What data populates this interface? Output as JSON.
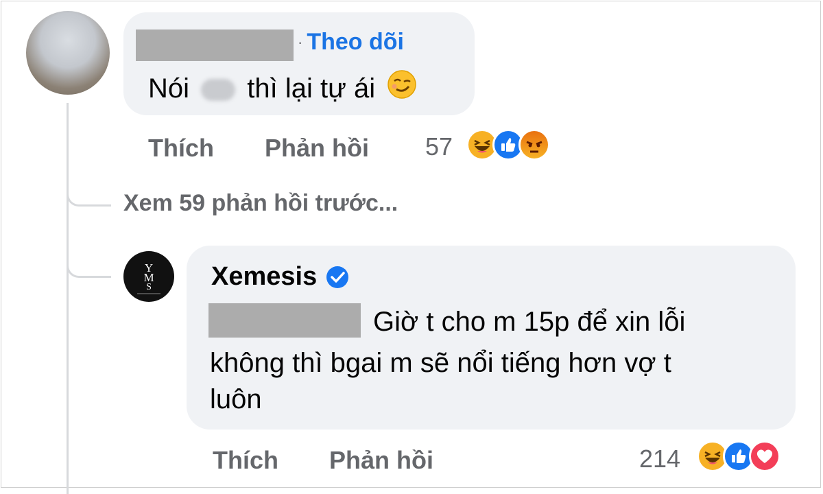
{
  "comment1": {
    "follow_label": "Theo dõi",
    "dot": "·",
    "text_before": "Nói",
    "text_after": "thì lại tự ái",
    "emoji_icon": "smirk-emoji-icon",
    "actions": {
      "like": "Thích",
      "reply": "Phản hồi"
    },
    "reaction_count": "57",
    "reactions": [
      "haha-icon",
      "like-icon",
      "angry-icon"
    ]
  },
  "view_previous": {
    "label": "Xem 59 phản hồi trước..."
  },
  "reply": {
    "author": "Xemesis",
    "verified_icon": "verified-badge-icon",
    "text_line1": "Giờ t cho m 15p để xin lỗi",
    "text_line2": "không thì bgai m sẽ nổi tiếng hơn vợ t",
    "text_line3": "luôn",
    "actions": {
      "like": "Thích",
      "reply": "Phản hồi"
    },
    "reaction_count": "214",
    "reactions": [
      "haha-icon",
      "like-icon",
      "love-icon"
    ]
  },
  "colors": {
    "bubble": "#f0f2f5",
    "link": "#1b74e4",
    "meta_text": "#65676b",
    "like_blue": "#1877f2",
    "haha_yellow": "#f7b125",
    "angry_orange": "#e9710f",
    "love_red": "#f33e58"
  }
}
